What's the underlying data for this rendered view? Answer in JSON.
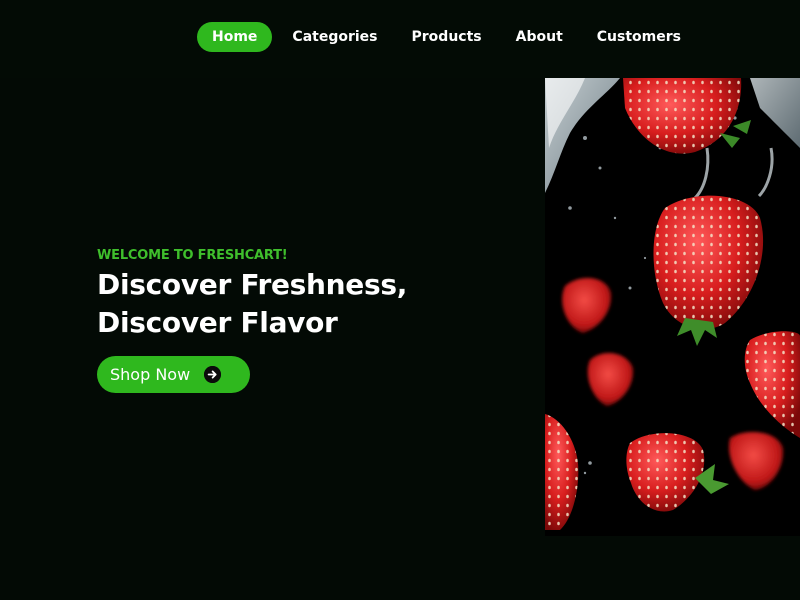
{
  "nav": {
    "items": [
      {
        "label": "Home",
        "active": true
      },
      {
        "label": "Categories",
        "active": false
      },
      {
        "label": "Products",
        "active": false
      },
      {
        "label": "About",
        "active": false
      },
      {
        "label": "Customers",
        "active": false
      }
    ]
  },
  "hero": {
    "eyebrow": "WELCOME TO FRESHCART!",
    "headline_line1": "Discover Freshness,",
    "headline_line2": "Discover Flavor",
    "cta_label": "Shop Now",
    "cta_icon": "arrow-right-circle-icon",
    "image_subject": "strawberries-splash-image"
  },
  "colors": {
    "background": "#030a05",
    "accent": "#2fb81e",
    "eyebrow": "#3fbf2c",
    "text": "#ffffff"
  }
}
